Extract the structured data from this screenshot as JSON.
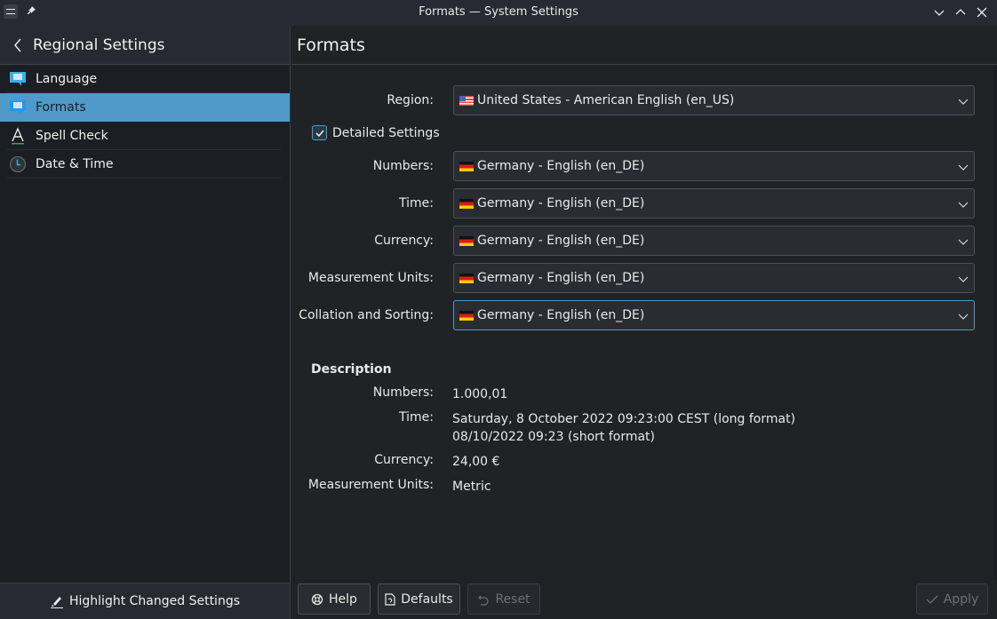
{
  "window": {
    "title": "Formats — System Settings",
    "controls": [
      "minimize",
      "maximize",
      "close"
    ]
  },
  "sidebar": {
    "header": "Regional Settings",
    "items": [
      {
        "label": "Language",
        "icon": "speech-bubble-icon",
        "active": false
      },
      {
        "label": "Formats",
        "icon": "speech-bubble-icon",
        "active": true
      },
      {
        "label": "Spell Check",
        "icon": "spell-check-icon",
        "active": false
      },
      {
        "label": "Date & Time",
        "icon": "clock-icon",
        "active": false
      }
    ],
    "footer": "Highlight Changed Settings"
  },
  "main": {
    "title": "Formats",
    "region": {
      "label": "Region:",
      "value": "United States - American English (en_US)",
      "flag": "us"
    },
    "detailed": {
      "label": "Detailed Settings",
      "checked": true
    },
    "fields": [
      {
        "label": "Numbers:",
        "value": "Germany - English (en_DE)",
        "flag": "de"
      },
      {
        "label": "Time:",
        "value": "Germany - English (en_DE)",
        "flag": "de"
      },
      {
        "label": "Currency:",
        "value": "Germany - English (en_DE)",
        "flag": "de"
      },
      {
        "label": "Measurement Units:",
        "value": "Germany - English (en_DE)",
        "flag": "de"
      },
      {
        "label": "Collation and Sorting:",
        "value": "Germany - English (en_DE)",
        "flag": "de",
        "focused": true
      }
    ],
    "description": {
      "heading": "Description",
      "numbers": {
        "label": "Numbers:",
        "value": "1.000,01"
      },
      "time": {
        "label": "Time:",
        "long": "Saturday, 8 October 2022 09:23:00 CEST (long format)",
        "short": "08/10/2022 09:23 (short format)"
      },
      "currency": {
        "label": "Currency:",
        "value": "24,00 €"
      },
      "measurement": {
        "label": "Measurement Units:",
        "value": "Metric"
      }
    }
  },
  "buttons": {
    "help": "Help",
    "defaults": "Defaults",
    "reset": "Reset",
    "apply": "Apply"
  },
  "colors": {
    "accent": "#4f9ac9",
    "background": "#202326",
    "sidebar": "#1b1e23"
  }
}
